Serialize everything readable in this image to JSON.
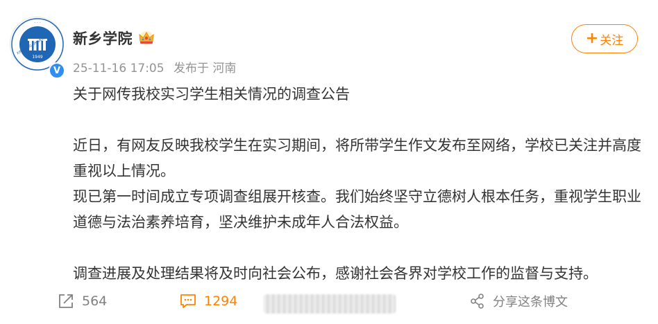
{
  "account": {
    "name": "新乡学院",
    "avatar_icon": "xinxiang-university-logo",
    "avatar_year": "1949",
    "avatar_en_text": "XINXIANG UNIVERSITY",
    "verified_badge": "V"
  },
  "post": {
    "date": "25-11-16 17:05",
    "source": "发布于 河南",
    "title_line": "关于网传我校实习学生相关情况的调查公告",
    "para1": "近日，有网友反映我校学生在实习期间，将所带学生作文发布至网络，学校已关注并高度重视以上情况。",
    "para2": "现已第一时间成立专项调查组展开核查。我们始终坚守立德树人根本任务，重视学生职业道德与法治素养培育，坚决维护未成年人合法权益。",
    "para3": "调查进展及处理结果将及时向社会公布，感谢社会各界对学校工作的监督与支持。"
  },
  "follow_button": {
    "plus": "+",
    "label": "关注"
  },
  "actions": {
    "repost_count": "564",
    "comment_count": "1294",
    "share_label": "分享这条博文"
  },
  "colors": {
    "accent": "#ff8200",
    "text": "#333333",
    "meta": "#939393",
    "verified": "#2f8ef0",
    "logo_blue": "#1f66b5"
  }
}
